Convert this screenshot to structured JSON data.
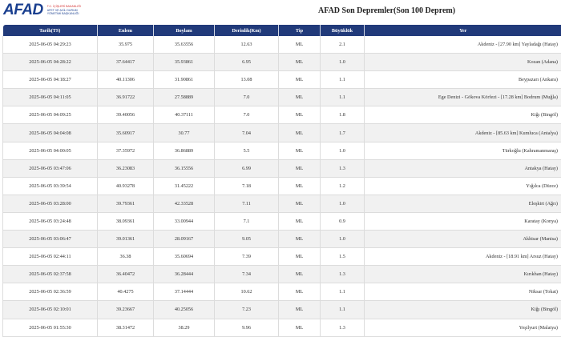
{
  "logo": {
    "brand": "AFAD",
    "sub1": "T.C. İÇİŞLERİ BAKANLIĞI",
    "sub2": "AFET VE ACİL DURUM",
    "sub3": "YÖNETİMİ BAŞKANLIĞI"
  },
  "page_title": "AFAD Son Depremler(Son 100 Deprem)",
  "table": {
    "headers": [
      "Tarih(TS)",
      "Enlem",
      "Boylam",
      "Derinlik(Km)",
      "Tip",
      "Büyüklük",
      "Yer"
    ],
    "rows": [
      [
        "2025-06-05 04:29:23",
        "35.975",
        "35.63556",
        "12.63",
        "ML",
        "2.1",
        "Akdeniz - [27.90 km] Yayladağı (Hatay)"
      ],
      [
        "2025-06-05 04:28:22",
        "37.64417",
        "35.93861",
        "6.95",
        "ML",
        "1.0",
        "Kozan (Adana)"
      ],
      [
        "2025-06-05 04:18:27",
        "40.11306",
        "31.90861",
        "13.08",
        "ML",
        "1.1",
        "Beypazarı (Ankara)"
      ],
      [
        "2025-06-05 04:11:05",
        "36.91722",
        "27.58889",
        "7.0",
        "ML",
        "1.1",
        "Ege Denizi - Gökova Körfezi - [17.28 km] Bodrum (Muğla)"
      ],
      [
        "2025-06-05 04:09:25",
        "39.40056",
        "40.37111",
        "7.0",
        "ML",
        "1.8",
        "Kiğı (Bingöl)"
      ],
      [
        "2025-06-05 04:04:08",
        "35.60917",
        "30.77",
        "7.04",
        "ML",
        "1.7",
        "Akdeniz - [85.63 km] Kumluca (Antalya)"
      ],
      [
        "2025-06-05 04:00:05",
        "37.35972",
        "36.86889",
        "5.5",
        "ML",
        "1.0",
        "Türkoğlu (Kahramanmaraş)"
      ],
      [
        "2025-06-05 03:47:06",
        "36.23083",
        "36.15556",
        "6.99",
        "ML",
        "1.3",
        "Antakya (Hatay)"
      ],
      [
        "2025-06-05 03:39:54",
        "40.93278",
        "31.45222",
        "7.18",
        "ML",
        "1.2",
        "Yığılca (Düzce)"
      ],
      [
        "2025-06-05 03:28:00",
        "39.79361",
        "42.33528",
        "7.11",
        "ML",
        "1.0",
        "Eleşkirt (Ağrı)"
      ],
      [
        "2025-06-05 03:24:48",
        "38.09361",
        "33.00944",
        "7.1",
        "ML",
        "0.9",
        "Karatay (Konya)"
      ],
      [
        "2025-06-05 03:06:47",
        "39.01361",
        "28.09167",
        "9.05",
        "ML",
        "1.0",
        "Akhisar (Manisa)"
      ],
      [
        "2025-06-05 02:44:11",
        "36.38",
        "35.60694",
        "7.39",
        "ML",
        "1.5",
        "Akdeniz - [18.91 km] Arsuz (Hatay)"
      ],
      [
        "2025-06-05 02:37:58",
        "36.40472",
        "36.28444",
        "7.34",
        "ML",
        "1.3",
        "Kırıkhan (Hatay)"
      ],
      [
        "2025-06-05 02:36:59",
        "40.4275",
        "37.14444",
        "10.62",
        "ML",
        "1.1",
        "Niksar (Tokat)"
      ],
      [
        "2025-06-05 02:10:01",
        "39.23667",
        "40.25056",
        "7.23",
        "ML",
        "1.1",
        "Kiğı (Bingöl)"
      ],
      [
        "2025-06-05 01:55:30",
        "38.31472",
        "38.29",
        "9.96",
        "ML",
        "1.3",
        "Yeşilyurt (Malatya)"
      ]
    ]
  },
  "colors": {
    "header_bg": "#213a7a",
    "brand_blue": "#1a3f8f",
    "row_stripe": "#f1f1f1"
  }
}
